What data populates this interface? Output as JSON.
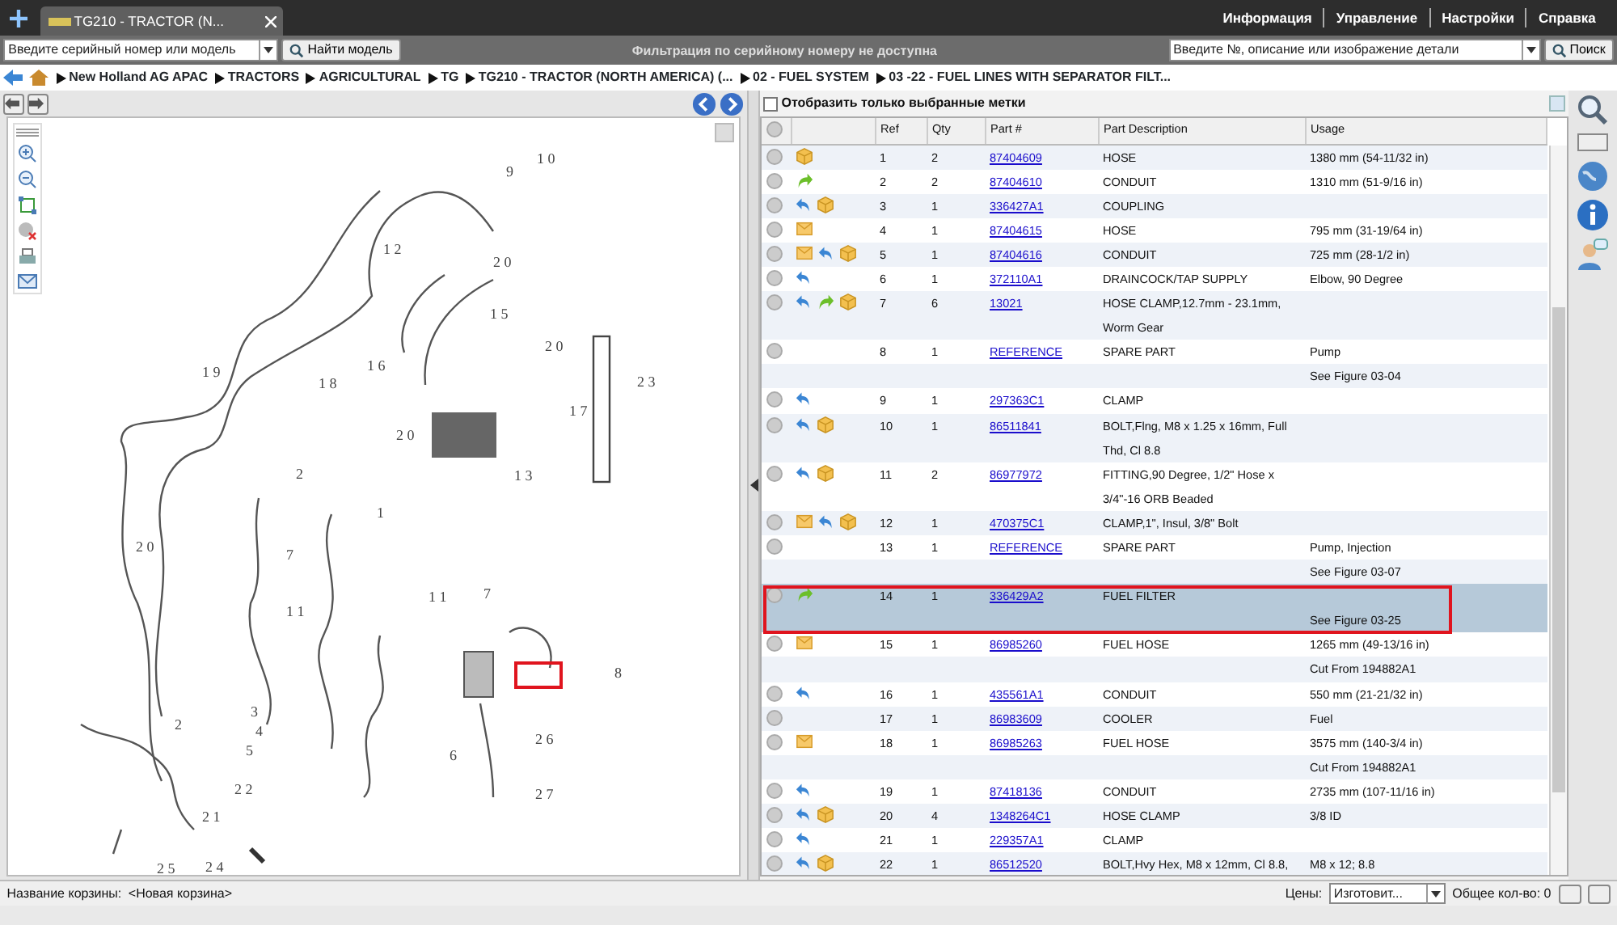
{
  "tab": {
    "title": "TG210 - TRACTOR (N...",
    "selected": true
  },
  "top_menu": [
    "Информация",
    "Управление",
    "Настройки",
    "Справка"
  ],
  "toolbar": {
    "model_placeholder": "Введите серийный номер или модель",
    "find_button": "Найти модель",
    "filter_message": "Фильтрация по серийному номеру не доступна",
    "part_placeholder": "Введите №, описание или изображение детали",
    "search_button": "Поиск"
  },
  "breadcrumb": [
    "New Holland AG APAC",
    "TRACTORS",
    "AGRICULTURAL",
    "TG",
    "TG210 - TRACTOR (NORTH AMERICA) (...",
    "02 - FUEL SYSTEM",
    "03 -22 - FUEL LINES WITH SEPARATOR FILT..."
  ],
  "diagram": {
    "callouts": [
      "1 0",
      "9",
      "1 2",
      "2 0",
      "1 5",
      "2 0",
      "1 6",
      "1 9",
      "1 8",
      "2 3",
      "1 7",
      "2 0",
      "1 3",
      "2",
      "1",
      "2 0",
      "7",
      "1 1",
      "7",
      "1 1",
      "8",
      "3",
      "4",
      "5",
      "6",
      "2 6",
      "2",
      "2 2",
      "2 1",
      "2 7",
      "2 5",
      "2 4"
    ]
  },
  "table": {
    "filter_label": "Отобразить только выбранные метки",
    "filter_checked": false,
    "columns": [
      "Ref",
      "Qty",
      "Part #",
      "Part Description",
      "Usage"
    ],
    "rows": [
      {
        "kind": "part",
        "ref": "1",
        "qty": "2",
        "part": "87404609",
        "description": "HOSE",
        "usage": "1380 mm (54-11/32 in)",
        "icons": [
          {
            "kind": "box"
          }
        ],
        "selected": false
      },
      {
        "kind": "part",
        "ref": "2",
        "qty": "2",
        "part": "87404610",
        "description": "CONDUIT",
        "usage": "1310 mm (51-9/16 in)",
        "icons": [
          {
            "kind": "forward"
          }
        ],
        "selected": false
      },
      {
        "kind": "part",
        "ref": "3",
        "qty": "1",
        "part": "336427A1",
        "description": "COUPLING",
        "icons": [
          {
            "kind": "back"
          },
          {
            "kind": "box"
          }
        ],
        "selected": false
      },
      {
        "kind": "part",
        "ref": "4",
        "qty": "1",
        "part": "87404615",
        "description": "HOSE",
        "usage": "795 mm (31-19/64 in)",
        "icons": [
          {
            "kind": "note"
          }
        ],
        "selected": false
      },
      {
        "kind": "part",
        "ref": "5",
        "qty": "1",
        "part": "87404616",
        "description": "CONDUIT",
        "usage": "725 mm (28-1/2 in)",
        "icons": [
          {
            "kind": "note"
          },
          {
            "kind": "back"
          },
          {
            "kind": "box"
          }
        ],
        "selected": false
      },
      {
        "kind": "part",
        "ref": "6",
        "qty": "1",
        "part": "372110A1",
        "description": "DRAINCOCK/TAP SUPPLY",
        "usage": "Elbow, 90 Degree",
        "icons": [
          {
            "kind": "back"
          }
        ],
        "selected": false
      },
      {
        "kind": "part",
        "ref": "7",
        "qty": "6",
        "part": "13021",
        "description": "HOSE CLAMP,12.7mm - 23.1mm, Worm Gear",
        "icons": [
          {
            "kind": "back"
          },
          {
            "kind": "forward"
          },
          {
            "kind": "box"
          }
        ],
        "selected": false
      },
      {
        "kind": "part",
        "ref": "8",
        "qty": "1",
        "part": "REFERENCE",
        "description": "SPARE PART",
        "usage": "Pump",
        "icons": [],
        "selected": false
      },
      {
        "kind": "usage-line",
        "usage": "See Figure 03-04",
        "selected": false
      },
      {
        "kind": "part",
        "ref": "9",
        "qty": "1",
        "part": "297363C1",
        "description": "CLAMP",
        "icons": [
          {
            "kind": "back"
          }
        ],
        "selected": false
      },
      {
        "kind": "part",
        "ref": "10",
        "qty": "1",
        "part": "86511841",
        "description": "BOLT,Flng, M8 x 1.25 x 16mm, Full Thd, Cl 8.8",
        "icons": [
          {
            "kind": "back"
          },
          {
            "kind": "box"
          }
        ],
        "selected": false
      },
      {
        "kind": "part",
        "ref": "11",
        "qty": "2",
        "part": "86977972",
        "description": "FITTING,90 Degree, 1/2\" Hose x 3/4\"-16 ORB Beaded",
        "icons": [
          {
            "kind": "back"
          },
          {
            "kind": "box"
          }
        ],
        "selected": false
      },
      {
        "kind": "part",
        "ref": "12",
        "qty": "1",
        "part": "470375C1",
        "description": "CLAMP,1\", Insul, 3/8\" Bolt",
        "icons": [
          {
            "kind": "note"
          },
          {
            "kind": "back"
          },
          {
            "kind": "box"
          }
        ],
        "selected": false
      },
      {
        "kind": "part",
        "ref": "13",
        "qty": "1",
        "part": "REFERENCE",
        "description": "SPARE PART",
        "usage": "Pump, Injection",
        "icons": [],
        "selected": false
      },
      {
        "kind": "usage-line",
        "usage": "See Figure 03-07",
        "selected": false
      },
      {
        "kind": "part",
        "ref": "14",
        "qty": "1",
        "part": "336429A2",
        "description": "FUEL FILTER",
        "icons": [
          {
            "kind": "forward"
          }
        ],
        "selected": true
      },
      {
        "kind": "usage-line",
        "usage": "See Figure 03-25",
        "selected": true
      },
      {
        "kind": "part",
        "ref": "15",
        "qty": "1",
        "part": "86985260",
        "description": "FUEL HOSE",
        "usage": "1265 mm (49-13/16 in)",
        "icons": [
          {
            "kind": "note"
          }
        ],
        "selected": false
      },
      {
        "kind": "usage-line",
        "usage": "Cut From 194882A1",
        "selected": false
      },
      {
        "kind": "part",
        "ref": "16",
        "qty": "1",
        "part": "435561A1",
        "description": "CONDUIT",
        "usage": "550 mm (21-21/32 in)",
        "icons": [
          {
            "kind": "back"
          }
        ],
        "selected": false
      },
      {
        "kind": "part",
        "ref": "17",
        "qty": "1",
        "part": "86983609",
        "description": "COOLER",
        "usage": "Fuel",
        "icons": [],
        "selected": false
      },
      {
        "kind": "part",
        "ref": "18",
        "qty": "1",
        "part": "86985263",
        "description": "FUEL HOSE",
        "usage": "3575 mm (140-3/4 in)",
        "icons": [
          {
            "kind": "note"
          }
        ],
        "selected": false
      },
      {
        "kind": "usage-line",
        "usage": "Cut From 194882A1",
        "selected": false
      },
      {
        "kind": "part",
        "ref": "19",
        "qty": "1",
        "part": "87418136",
        "description": "CONDUIT",
        "usage": "2735 mm (107-11/16 in)",
        "icons": [
          {
            "kind": "back"
          }
        ],
        "selected": false
      },
      {
        "kind": "part",
        "ref": "20",
        "qty": "4",
        "part": "1348264C1",
        "description": "HOSE CLAMP",
        "usage": "3/8 ID",
        "icons": [
          {
            "kind": "back"
          },
          {
            "kind": "box"
          }
        ],
        "selected": false
      },
      {
        "kind": "part",
        "ref": "21",
        "qty": "1",
        "part": "229357A1",
        "description": "CLAMP",
        "icons": [
          {
            "kind": "back"
          }
        ],
        "selected": false
      },
      {
        "kind": "part",
        "ref": "22",
        "qty": "1",
        "part": "86512520",
        "description": "BOLT,Hvy Hex, M8 x 12mm, Cl 8.8,",
        "usage": "M8 x 12; 8.8",
        "icons": [
          {
            "kind": "back"
          },
          {
            "kind": "box"
          }
        ],
        "selected": false
      }
    ]
  },
  "status_bar": {
    "cart_label": "Название корзины:",
    "cart_name": "<Новая корзина>",
    "prices_label": "Цены:",
    "prices_value": "Изготовит...",
    "total": "Общее кол-во: 0"
  }
}
